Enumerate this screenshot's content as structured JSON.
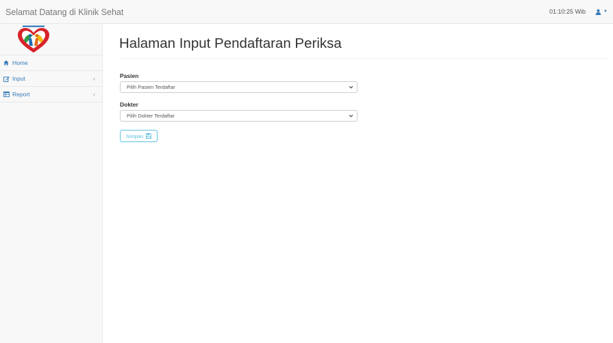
{
  "navbar": {
    "brand": "Selamat Datang di Klinik Sehat",
    "clock": "01:10:25 Wib",
    "user_icon": "user-icon"
  },
  "sidebar": {
    "items": [
      {
        "label": "Home",
        "icon": "home-icon",
        "has_submenu": false
      },
      {
        "label": "Input",
        "icon": "edit-icon",
        "has_submenu": true
      },
      {
        "label": "Report",
        "icon": "table-icon",
        "has_submenu": true
      }
    ]
  },
  "main": {
    "title": "Halaman Input Pendaftaran Periksa",
    "pasien": {
      "label": "Pasien",
      "selected": "Pilih Pasien Terdaftar"
    },
    "dokter": {
      "label": "Dokter",
      "selected": "Pilih Dokter Terdaftar"
    },
    "save_label": "Simpan"
  },
  "colors": {
    "link": "#337ab7",
    "button_info": "#5bc0de",
    "navbar_bg": "#f8f8f8"
  }
}
